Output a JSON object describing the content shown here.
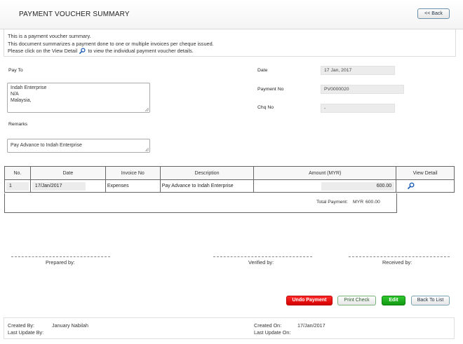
{
  "header": {
    "title": "PAYMENT VOUCHER SUMMARY",
    "back_label": "<< Back"
  },
  "info": {
    "line1": "This is a payment voucher summary.",
    "line2": "This document summarizes a payment done to one or multiple invoices per cheque issued.",
    "line3a": "Please click on the View Detail",
    "line3b": "to view the individual payment voucher details."
  },
  "form": {
    "pay_to_label": "Pay To",
    "pay_to_lines": [
      "Indah Enterprise",
      "N/A",
      "Malaysia,"
    ],
    "remarks_label": "Remarks",
    "remarks_value": "Pay Advance to Indah Enterprise",
    "date_label": "Date",
    "date_value": "17 Jan, 2017",
    "payment_no_label": "Payment No",
    "payment_no_value": "PV0000020",
    "chq_no_label": "Chq No",
    "chq_no_value": "-"
  },
  "table": {
    "headers": {
      "no": "No.",
      "date": "Date",
      "invoice": "Invoice No",
      "description": "Description",
      "amount": "Amount (MYR)",
      "view": "View Detail"
    },
    "rows": [
      {
        "no": "1",
        "date": "17/Jan/2017",
        "invoice": "Expenses",
        "description": "Pay Advance to Indah Enterprise",
        "amount": "600.00"
      }
    ],
    "total_label": "Total Payment:",
    "total_currency": "MYR",
    "total_value": "600.00"
  },
  "signatures": {
    "prepared": "Prepared by:",
    "verified": "Verified by:",
    "received": "Received by:"
  },
  "actions": {
    "undo": "Undo Payment",
    "print": "Print Check",
    "edit": "Edit",
    "back_to_list": "Back To List"
  },
  "footer": {
    "created_by_label": "Created By:",
    "created_by_value": "January Nabilah",
    "last_update_by_label": "Last Update By:",
    "created_on_label": "Created On:",
    "created_on_value": "17/Jan/2017",
    "last_update_on_label": "Last Update On:"
  },
  "colors": {
    "undo": "#e60000",
    "edit": "#1fae1f",
    "magnifier": "#1f5fb8"
  }
}
